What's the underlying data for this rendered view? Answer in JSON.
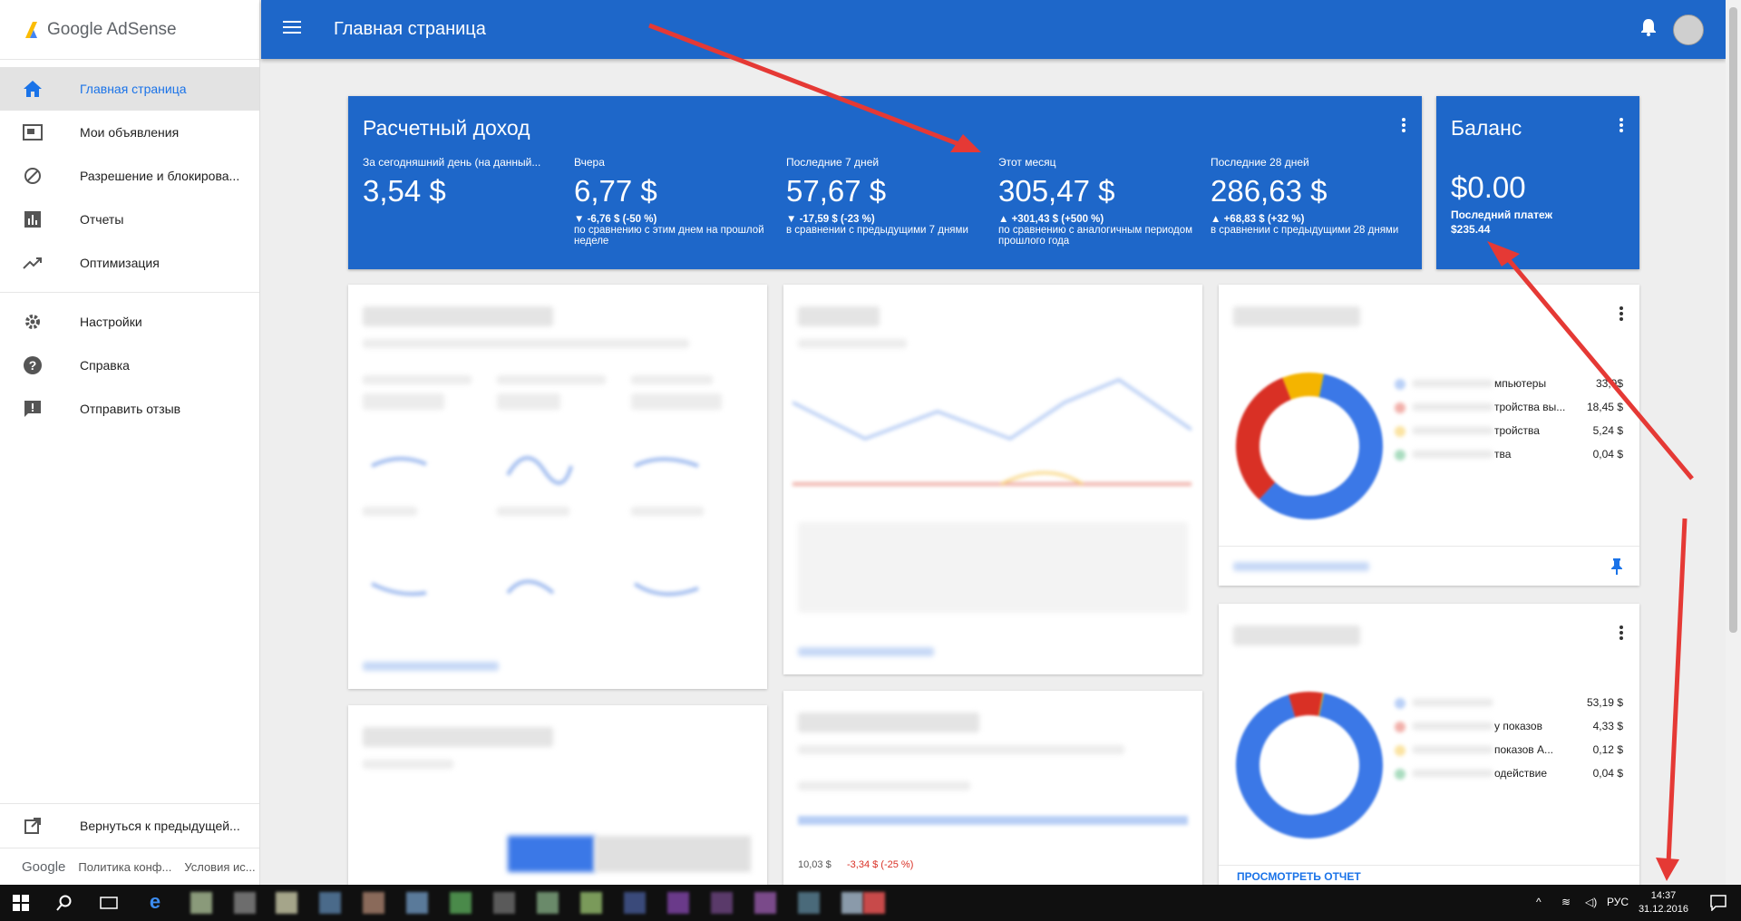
{
  "app": {
    "logo_text": "Google AdSense",
    "page_title": "Главная страница"
  },
  "sidebar": {
    "items": [
      {
        "label": "Главная страница"
      },
      {
        "label": "Мои объявления"
      },
      {
        "label": "Разрешение и блокирова..."
      },
      {
        "label": "Отчеты"
      },
      {
        "label": "Оптимизация"
      },
      {
        "label": "Настройки"
      },
      {
        "label": "Справка"
      },
      {
        "label": "Отправить отзыв"
      }
    ],
    "back_label": "Вернуться к предыдущей...",
    "footer": {
      "google": "Google",
      "privacy": "Политика конф...",
      "terms": "Условия ис..."
    }
  },
  "income": {
    "title": "Расчетный доход",
    "stats": [
      {
        "label": "За сегодняшний день (на данный...",
        "value": "3,54 $",
        "change": "",
        "compare": ""
      },
      {
        "label": "Вчера",
        "value": "6,77 $",
        "change": "▼ -6,76 $ (-50 %)",
        "compare": "по сравнению с этим днем на прошлой неделе"
      },
      {
        "label": "Последние 7 дней",
        "value": "57,67 $",
        "change": "▼ -17,59 $ (-23 %)",
        "compare": "в сравнении с предыдущими 7 днями"
      },
      {
        "label": "Этот месяц",
        "value": "305,47 $",
        "change": "▲ +301,43 $ (+500 %)",
        "compare": "по сравнению с аналогичным периодом прошлого года"
      },
      {
        "label": "Последние 28 дней",
        "value": "286,63 $",
        "change": "▲ +68,83 $ (+32 %)",
        "compare": "в сравнении с предыдущими 28 днями"
      }
    ]
  },
  "balance": {
    "title": "Баланс",
    "value": "$0.00",
    "last_payment_label": "Последний платеж",
    "last_payment_value": "$235.44"
  },
  "platforms": {
    "rows": [
      {
        "text": "мпьютеры",
        "amount": "33,9$",
        "color": "#3b78e7"
      },
      {
        "text": "тройства вы...",
        "amount": "18,45 $",
        "color": "#d93025"
      },
      {
        "text": "тройства",
        "amount": "5,24 $",
        "color": "#f4b400"
      },
      {
        "text": "тва",
        "amount": "0,04 $",
        "color": "#0f9d58"
      }
    ]
  },
  "ad_types": {
    "rows": [
      {
        "text": "",
        "amount": "53,19 $",
        "color": "#3b78e7"
      },
      {
        "text": "у показов",
        "amount": "4,33 $",
        "color": "#d93025"
      },
      {
        "text": "показов А...",
        "amount": "0,12 $",
        "color": "#f4b400"
      },
      {
        "text": "одействие",
        "amount": "0,04 $",
        "color": "#0f9d58"
      }
    ],
    "view_report": "ПРОСМОТРЕТЬ ОТЧЕТ"
  },
  "ad_blocks_partial": {
    "line1": "10,03 $",
    "line2": "-3,34 $ (-25 %)"
  },
  "taskbar": {
    "lang": "РУС",
    "time": "14:37",
    "date": "31.12.2016"
  }
}
